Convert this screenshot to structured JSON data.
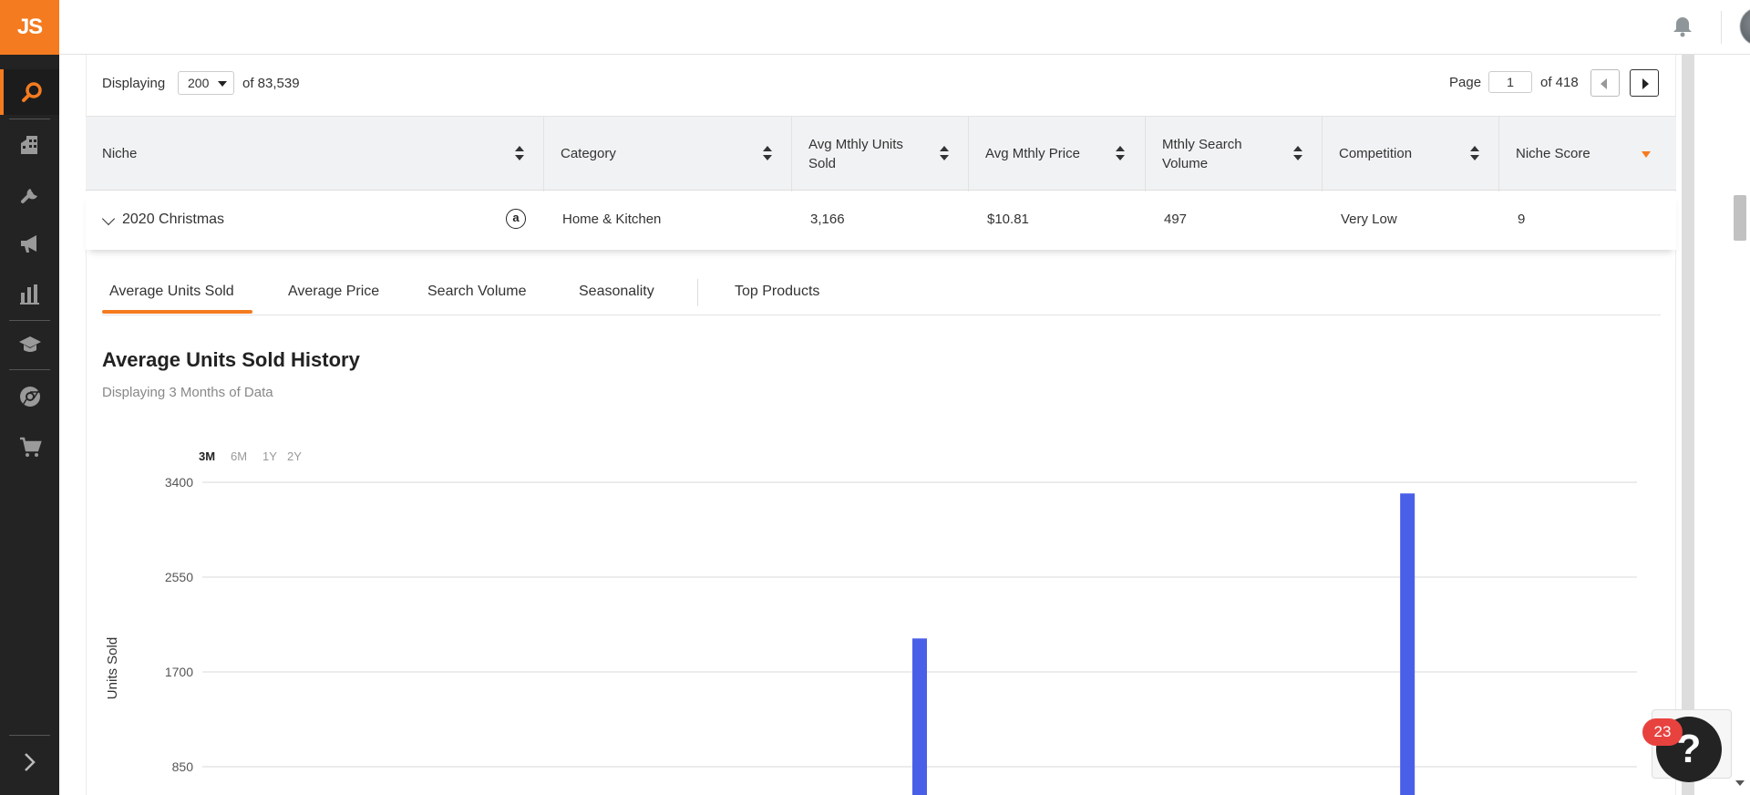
{
  "app": {
    "logo_text": "JS"
  },
  "sidebar": {
    "items": [
      {
        "name": "search-icon",
        "active": true
      },
      {
        "name": "buildings-icon",
        "active": false
      },
      {
        "name": "wrench-icon",
        "active": false
      },
      {
        "name": "megaphone-icon",
        "active": false
      },
      {
        "name": "bar-chart-icon",
        "active": false
      },
      {
        "name": "graduation-cap-icon",
        "active": false
      },
      {
        "name": "chrome-icon",
        "active": false
      },
      {
        "name": "cart-icon",
        "active": false
      }
    ],
    "expand_icon": "chevron-right-icon"
  },
  "topbar": {
    "notifications_icon": "bell-icon"
  },
  "toolbar": {
    "displaying_label": "Displaying",
    "page_size": "200",
    "of_total": "of 83,539",
    "page_label": "Page",
    "page_value": "1",
    "of_pages": "of 418"
  },
  "table": {
    "columns": [
      {
        "label": "Niche",
        "sort": "both"
      },
      {
        "label": "Category",
        "sort": "both"
      },
      {
        "label": "Avg Mthly Units Sold",
        "sort": "both"
      },
      {
        "label": "Avg Mthly Price",
        "sort": "both"
      },
      {
        "label": "Mthly Search Volume",
        "sort": "both"
      },
      {
        "label": "Competition",
        "sort": "both"
      },
      {
        "label": "Niche Score",
        "sort": "desc"
      }
    ],
    "rows": [
      {
        "niche": "2020 Christmas",
        "marketplace_icon": "a",
        "category": "Home & Kitchen",
        "avg_units": "3,166",
        "avg_price": "$10.81",
        "search_volume": "497",
        "competition": "Very Low",
        "niche_score": "9"
      }
    ]
  },
  "tabs": [
    {
      "label": "Average Units Sold",
      "active": true
    },
    {
      "label": "Average Price",
      "active": false
    },
    {
      "label": "Search Volume",
      "active": false
    },
    {
      "label": "Seasonality",
      "active": false
    },
    {
      "label": "Top Products",
      "active": false
    }
  ],
  "section": {
    "title": "Average Units Sold History",
    "subtitle": "Displaying 3 Months of Data"
  },
  "ranges": [
    {
      "label": "3M",
      "active": true
    },
    {
      "label": "6M",
      "active": false
    },
    {
      "label": "1Y",
      "active": false
    },
    {
      "label": "2Y",
      "active": false
    }
  ],
  "help": {
    "badge_count": "23",
    "glyph": "?"
  },
  "colors": {
    "accent": "#f47b20",
    "bar": "#4a5fe8",
    "sidebar": "#232323",
    "badge": "#e8423f"
  },
  "chart_data": {
    "type": "bar",
    "ylabel": "Units Sold",
    "yticks": [
      850,
      1700,
      2550,
      3400
    ],
    "ylim_visible": [
      600,
      3400
    ],
    "grid": true,
    "bars": [
      {
        "x_fraction": 0.5,
        "value": 2000
      },
      {
        "x_fraction": 0.84,
        "value": 3300
      }
    ]
  }
}
